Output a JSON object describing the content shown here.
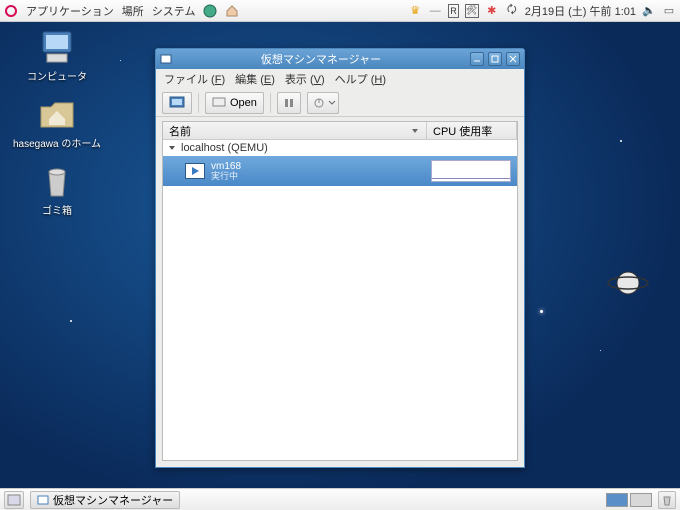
{
  "panel": {
    "menus": {
      "apps": "アプリケーション",
      "places": "場所",
      "system": "システム"
    },
    "clock": "2月19日 (土) 午前 1:01"
  },
  "desktop": {
    "computer": "コンピュータ",
    "home": "hasegawa のホーム",
    "trash": "ゴミ箱"
  },
  "win": {
    "title": "仮想マシンマネージャー",
    "menu": {
      "file": "ファイル",
      "file_u": "F",
      "edit": "編集",
      "edit_u": "E",
      "view": "表示",
      "view_u": "V",
      "help": "ヘルプ",
      "help_u": "H"
    },
    "toolbar": {
      "open": "Open"
    },
    "cols": {
      "name": "名前",
      "cpu": "CPU 使用率"
    },
    "host": "localhost (QEMU)",
    "vm": {
      "name": "vm168",
      "status": "実行中"
    }
  },
  "taskbar": {
    "task1": "仮想マシンマネージャー"
  }
}
